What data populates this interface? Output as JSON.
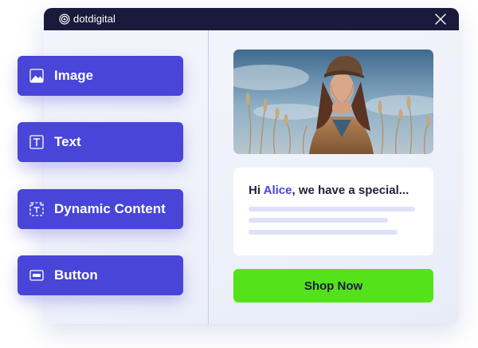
{
  "app": {
    "brand": "dotdigital"
  },
  "blocks": [
    {
      "label": "Image",
      "icon": "image-icon"
    },
    {
      "label": "Text",
      "icon": "text-icon"
    },
    {
      "label": "Dynamic Content",
      "icon": "dynamic-content-icon"
    },
    {
      "label": "Button",
      "icon": "button-icon"
    }
  ],
  "preview": {
    "greeting_prefix": "Hi ",
    "greeting_name": "Alice",
    "greeting_suffix": ", we have a special...",
    "cta_label": "Shop Now"
  },
  "colors": {
    "accent": "#4845d8",
    "cta": "#54e21a",
    "titlebar": "#1c1a3c"
  }
}
